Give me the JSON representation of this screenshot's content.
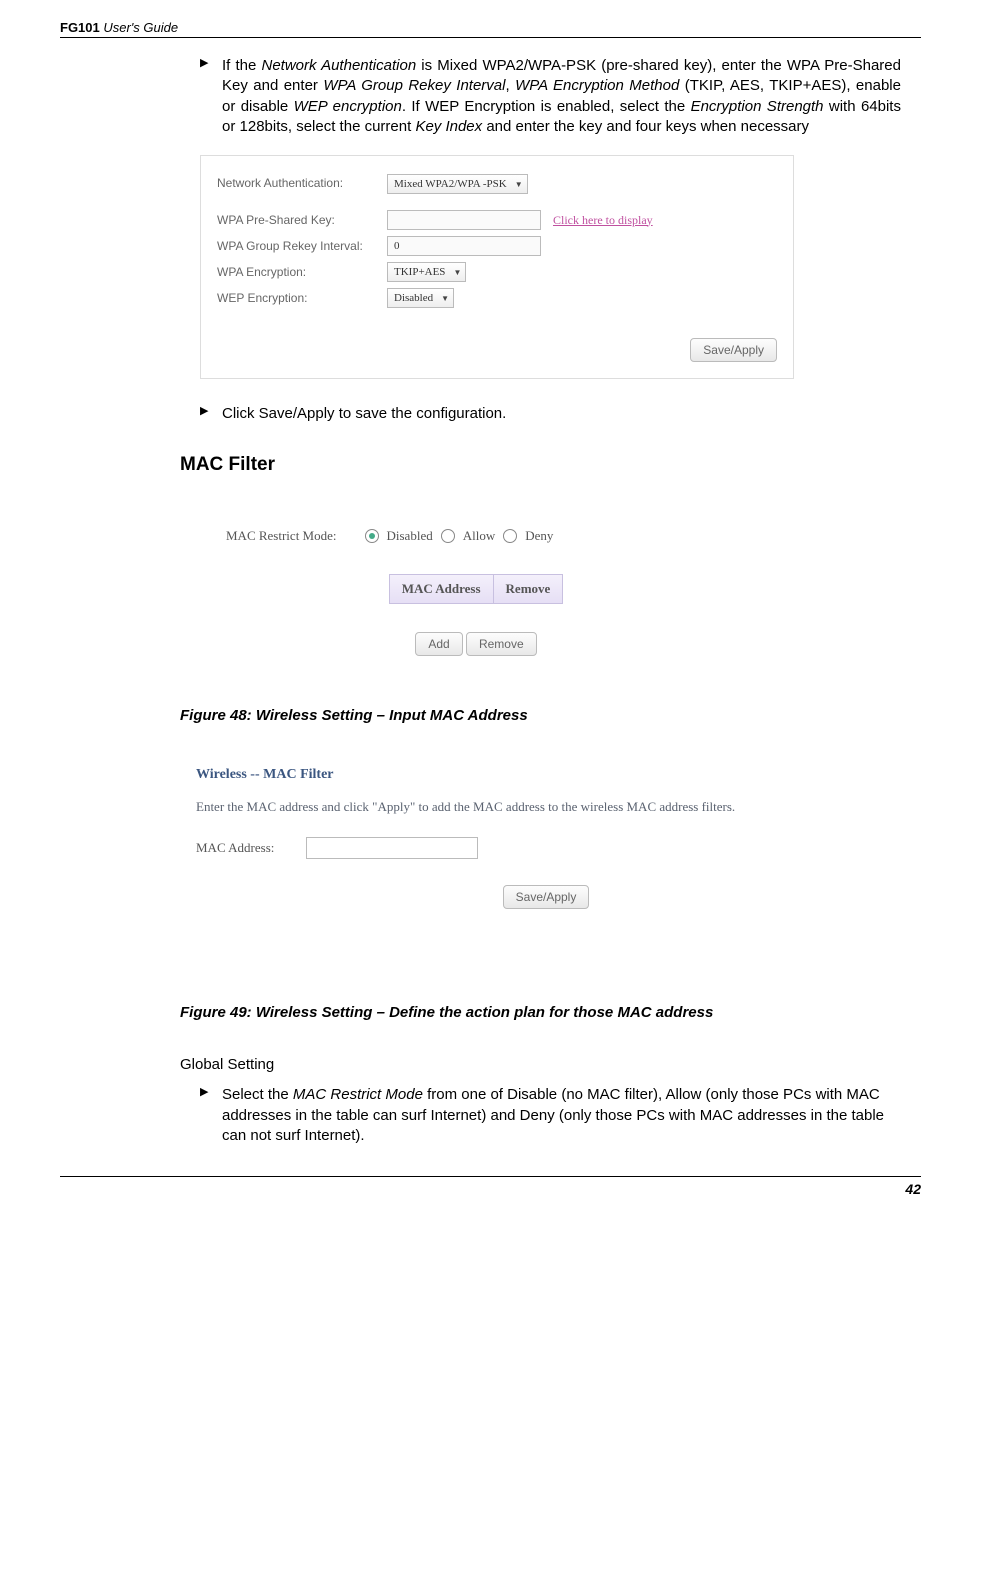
{
  "header": {
    "product": "FG101",
    "doc": "User's Guide"
  },
  "bullets": {
    "b1_pre": "If the ",
    "b1_i1": "Network Authentication",
    "b1_t1": " is Mixed WPA2/WPA-PSK (pre-shared key), enter the WPA Pre-Shared Key and enter ",
    "b1_i2": "WPA Group Rekey Interval",
    "b1_c1": ", ",
    "b1_i3": "WPA Encryption Method",
    "b1_t2": " (TKIP, AES, TKIP+AES), enable or disable ",
    "b1_i4": "WEP encryption",
    "b1_t3": ". If WEP Encryption is enabled, select the ",
    "b1_i5": "Encryption Strength",
    "b1_t4": " with 64bits or 128bits, select the current ",
    "b1_i6": "Key Index",
    "b1_t5": " and enter the key and four keys when necessary",
    "b2": "Click Save/Apply to save the configuration."
  },
  "panel1": {
    "netauth_label": "Network Authentication:",
    "netauth_value": "Mixed WPA2/WPA -PSK",
    "psk_label": "WPA Pre-Shared Key:",
    "psk_link": "Click here to display",
    "rekey_label": "WPA Group Rekey Interval:",
    "rekey_value": "0",
    "wpaenc_label": "WPA Encryption:",
    "wpaenc_value": "TKIP+AES",
    "wepenc_label": "WEP Encryption:",
    "wepenc_value": "Disabled",
    "save_btn": "Save/Apply"
  },
  "section_title": "MAC Filter",
  "panel2": {
    "mode_label": "MAC Restrict Mode:",
    "opt_disabled": "Disabled",
    "opt_allow": "Allow",
    "opt_deny": "Deny",
    "col_mac": "MAC Address",
    "col_remove": "Remove",
    "btn_add": "Add",
    "btn_remove": "Remove"
  },
  "caption1": "Figure 48: Wireless Setting – Input MAC Address",
  "panel3": {
    "title": "Wireless -- MAC Filter",
    "desc": "Enter the MAC address and click \"Apply\" to add the MAC address to the wireless MAC address filters.",
    "mac_label": "MAC Address:",
    "save_btn": "Save/Apply"
  },
  "caption2": "Figure 49: Wireless Setting – Define the action plan for those MAC address",
  "global_heading": "Global Setting",
  "bullets2": {
    "b1_pre": "Select the ",
    "b1_i1": "MAC Restrict Mode",
    "b1_t1": " from one of Disable (no MAC filter), Allow (only those PCs with MAC addresses in the table can surf Internet) and Deny (only those PCs with MAC addresses in the table can not surf Internet)."
  },
  "page_number": "42"
}
